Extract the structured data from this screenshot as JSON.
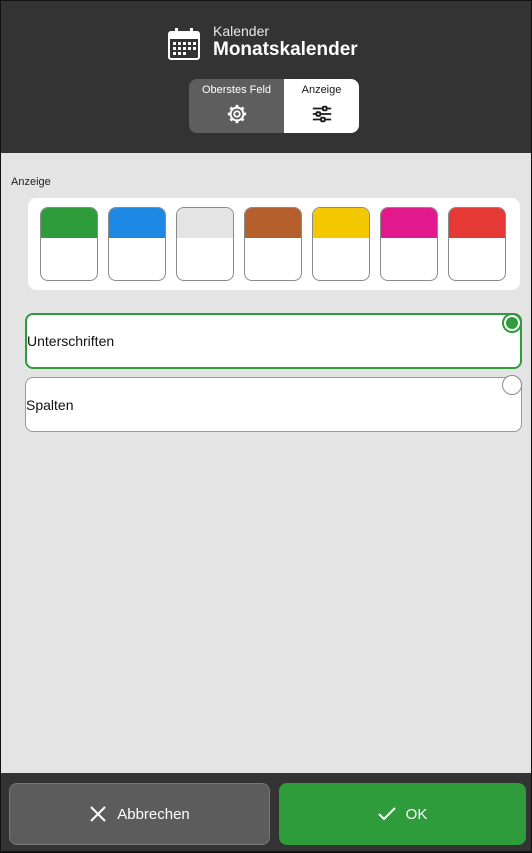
{
  "header": {
    "subtitle": "Kalender",
    "title": "Monatskalender",
    "icon": "calendar-icon"
  },
  "tabs": [
    {
      "label": "Oberstes Feld",
      "icon": "gear-icon",
      "active": false
    },
    {
      "label": "Anzeige",
      "icon": "sliders-icon",
      "active": true
    }
  ],
  "content": {
    "section_label": "Anzeige",
    "swatches": [
      {
        "color": "#2e9c3a",
        "name": "green"
      },
      {
        "color": "#1e88e5",
        "name": "blue"
      },
      {
        "color": "#e4e4e4",
        "name": "gray"
      },
      {
        "color": "#b5602c",
        "name": "brown"
      },
      {
        "color": "#f3c800",
        "name": "yellow"
      },
      {
        "color": "#e2198c",
        "name": "pink"
      },
      {
        "color": "#e53935",
        "name": "red"
      }
    ],
    "options": [
      {
        "label": "Unterschriften",
        "selected": true
      },
      {
        "label": "Spalten",
        "selected": false
      }
    ]
  },
  "footer": {
    "cancel_label": "Abbrechen",
    "ok_label": "OK"
  },
  "colors": {
    "accent": "#2e9c3a",
    "header_bg": "#333333",
    "content_bg": "#e4e4e4"
  }
}
